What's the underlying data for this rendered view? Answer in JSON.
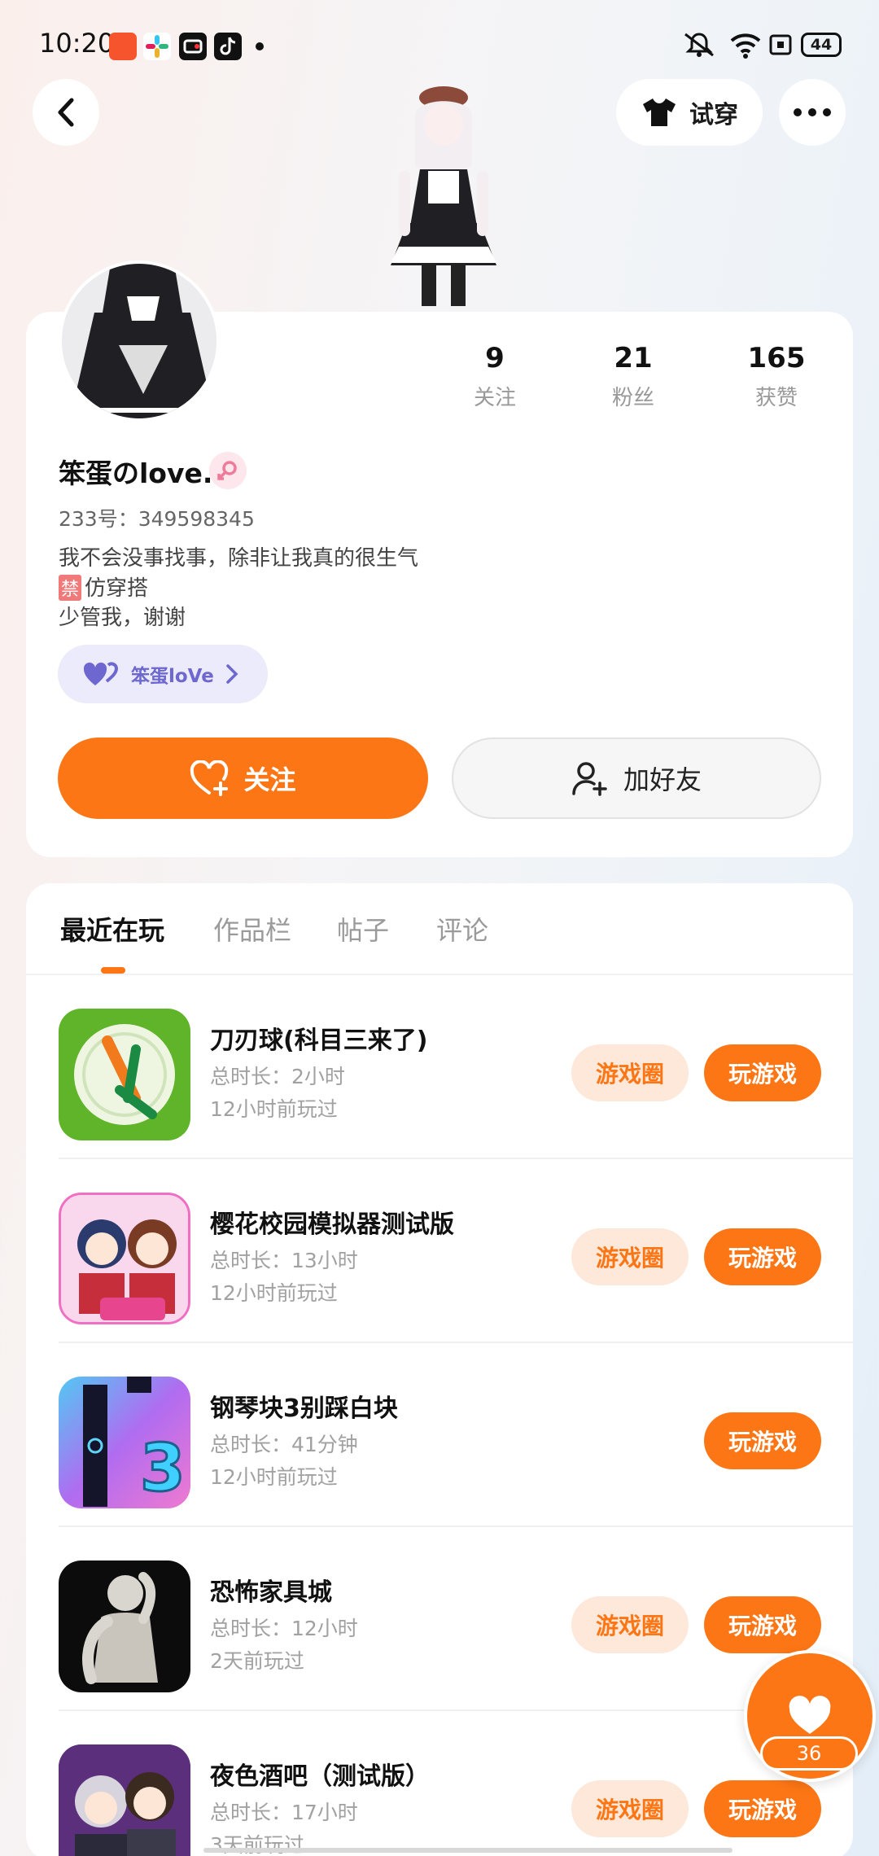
{
  "status_bar": {
    "time": "10:20",
    "battery": "44"
  },
  "header": {
    "tryon_label": "试穿"
  },
  "profile": {
    "stats": [
      {
        "num": "9",
        "label": "关注"
      },
      {
        "num": "21",
        "label": "粉丝"
      },
      {
        "num": "165",
        "label": "获赞"
      }
    ],
    "username": "笨蛋のlove.",
    "uid": "233号：349598345",
    "bio_lines": [
      "我不会没事找事，除非让我真的很生气",
      "仿穿搭",
      "少管我，谢谢"
    ],
    "ban_badge": "禁",
    "club_name": "笨蛋loVe",
    "follow_label": "关注",
    "add_friend_label": "加好友"
  },
  "tabs": [
    "最近在玩",
    "作品栏",
    "帖子",
    "评论"
  ],
  "games": [
    {
      "name": "刀刃球(科目三来了)",
      "duration": "总时长：2小时",
      "last_played": "12小时前玩过",
      "has_circle": true
    },
    {
      "name": "樱花校园模拟器测试版",
      "duration": "总时长：13小时",
      "last_played": "12小时前玩过",
      "has_circle": true
    },
    {
      "name": "钢琴块3别踩白块",
      "duration": "总时长：41分钟",
      "last_played": "12小时前玩过",
      "has_circle": false
    },
    {
      "name": "恐怖家具城",
      "duration": "总时长：12小时",
      "last_played": "2天前玩过",
      "has_circle": true
    },
    {
      "name": "夜色酒吧（测试版）",
      "duration": "总时长：17小时",
      "last_played": "3天前玩过",
      "has_circle": true
    }
  ],
  "buttons": {
    "circle_label": "游戏圈",
    "play_label": "玩游戏"
  },
  "like": {
    "count": "36"
  },
  "colors": {
    "accent": "#fd7615",
    "club": "#6d67cf"
  }
}
